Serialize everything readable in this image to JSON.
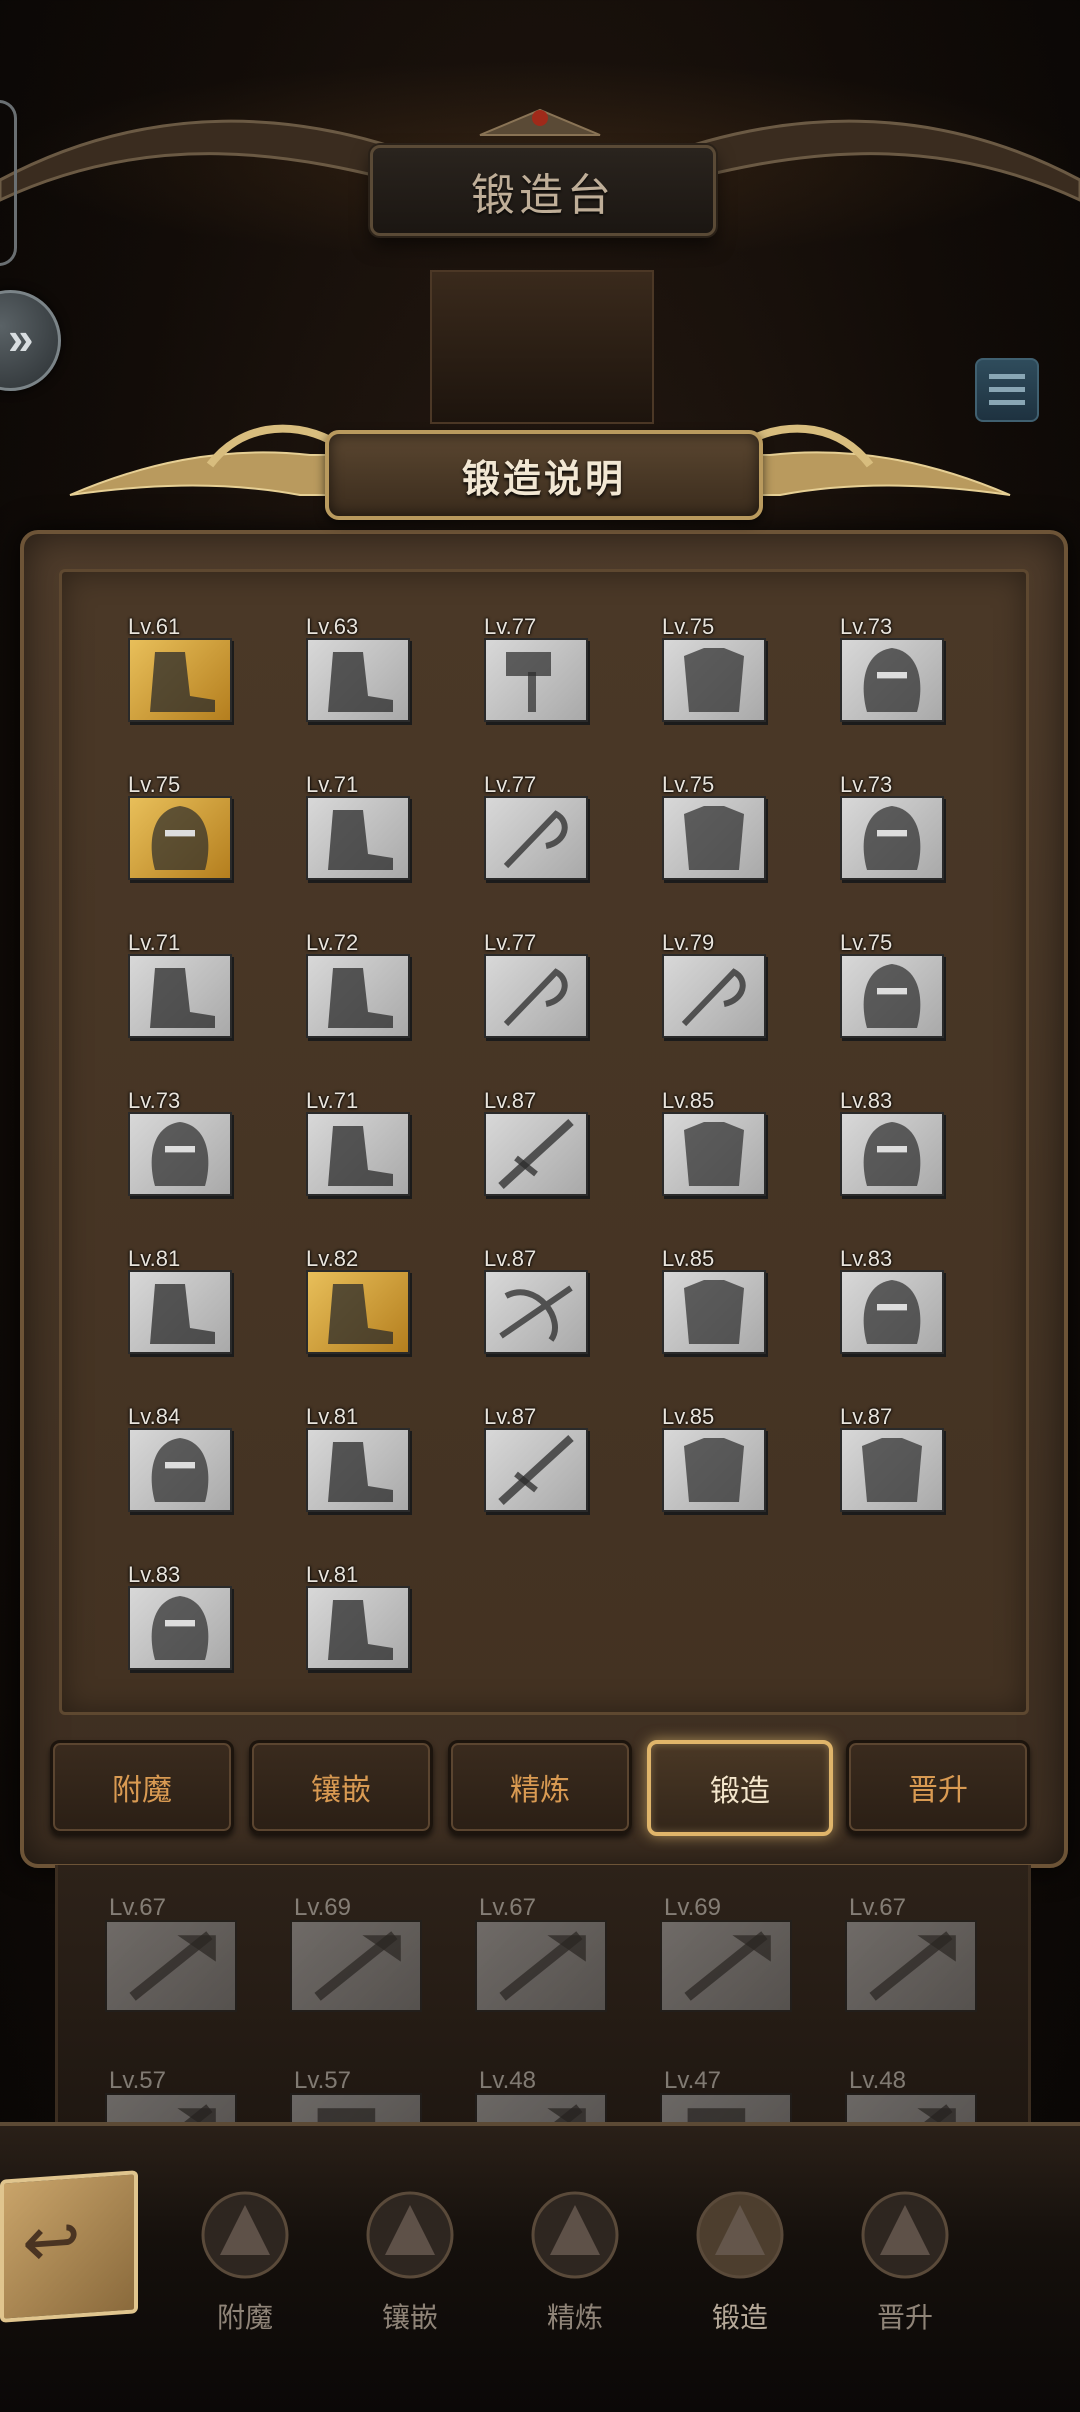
{
  "window_title": "锻造台",
  "panel_title": "锻造说明",
  "items": [
    {
      "lv": "Lv.61",
      "gold": true,
      "icon": "boots-icon"
    },
    {
      "lv": "Lv.63",
      "gold": false,
      "icon": "boots-icon"
    },
    {
      "lv": "Lv.77",
      "gold": false,
      "icon": "hammer-icon"
    },
    {
      "lv": "Lv.75",
      "gold": false,
      "icon": "armor-icon"
    },
    {
      "lv": "Lv.73",
      "gold": false,
      "icon": "helmet-icon"
    },
    {
      "lv": "Lv.75",
      "gold": true,
      "icon": "crown-helmet-icon"
    },
    {
      "lv": "Lv.71",
      "gold": false,
      "icon": "boots-icon"
    },
    {
      "lv": "Lv.77",
      "gold": false,
      "icon": "scythe-icon"
    },
    {
      "lv": "Lv.75",
      "gold": false,
      "icon": "armor-icon"
    },
    {
      "lv": "Lv.73",
      "gold": false,
      "icon": "helmet-icon"
    },
    {
      "lv": "Lv.71",
      "gold": false,
      "icon": "boots-icon"
    },
    {
      "lv": "Lv.72",
      "gold": false,
      "icon": "boots-icon"
    },
    {
      "lv": "Lv.77",
      "gold": false,
      "icon": "scythe-icon"
    },
    {
      "lv": "Lv.79",
      "gold": false,
      "icon": "scythe-icon"
    },
    {
      "lv": "Lv.75",
      "gold": false,
      "icon": "helmet-icon"
    },
    {
      "lv": "Lv.73",
      "gold": false,
      "icon": "helmet-icon"
    },
    {
      "lv": "Lv.71",
      "gold": false,
      "icon": "boots-icon"
    },
    {
      "lv": "Lv.87",
      "gold": false,
      "icon": "sword-icon"
    },
    {
      "lv": "Lv.85",
      "gold": false,
      "icon": "armor-icon"
    },
    {
      "lv": "Lv.83",
      "gold": false,
      "icon": "helmet-icon"
    },
    {
      "lv": "Lv.81",
      "gold": false,
      "icon": "boots-icon"
    },
    {
      "lv": "Lv.82",
      "gold": true,
      "icon": "boots-icon"
    },
    {
      "lv": "Lv.87",
      "gold": false,
      "icon": "crossbow-icon"
    },
    {
      "lv": "Lv.85",
      "gold": false,
      "icon": "armor-icon"
    },
    {
      "lv": "Lv.83",
      "gold": false,
      "icon": "helmet-icon"
    },
    {
      "lv": "Lv.84",
      "gold": false,
      "icon": "helmet-icon"
    },
    {
      "lv": "Lv.81",
      "gold": false,
      "icon": "boots-icon"
    },
    {
      "lv": "Lv.87",
      "gold": false,
      "icon": "spear-icon"
    },
    {
      "lv": "Lv.85",
      "gold": false,
      "icon": "armor-icon"
    },
    {
      "lv": "Lv.87",
      "gold": false,
      "icon": "armor-icon"
    },
    {
      "lv": "Lv.83",
      "gold": false,
      "icon": "helmet-icon"
    },
    {
      "lv": "Lv.81",
      "gold": false,
      "icon": "boots-icon"
    }
  ],
  "tabs": [
    {
      "label": "附魔",
      "active": false
    },
    {
      "label": "镶嵌",
      "active": false
    },
    {
      "label": "精炼",
      "active": false
    },
    {
      "label": "锻造",
      "active": true
    },
    {
      "label": "晋升",
      "active": false
    }
  ],
  "lower_items": [
    {
      "lv": "Lv.67",
      "icon": "mace-icon"
    },
    {
      "lv": "Lv.69",
      "icon": "axe-icon"
    },
    {
      "lv": "Lv.67",
      "icon": "axe-icon"
    },
    {
      "lv": "Lv.69",
      "icon": "axe-icon"
    },
    {
      "lv": "Lv.67",
      "icon": "axe-icon"
    },
    {
      "lv": "Lv.57",
      "icon": "mace-icon"
    },
    {
      "lv": "Lv.57",
      "icon": "hammer-icon"
    },
    {
      "lv": "Lv.48",
      "icon": "mace-icon"
    },
    {
      "lv": "Lv.47",
      "icon": "hammer-icon"
    },
    {
      "lv": "Lv.48",
      "icon": "mace-icon"
    }
  ],
  "bottom_nav": [
    {
      "label": "附魔",
      "icon": "enchant-icon"
    },
    {
      "label": "镶嵌",
      "icon": "inlay-icon"
    },
    {
      "label": "精炼",
      "icon": "refine-icon"
    },
    {
      "label": "锻造",
      "icon": "forge-icon",
      "active": true
    },
    {
      "label": "晋升",
      "icon": "promote-icon"
    }
  ],
  "colors": {
    "tab_text": "#d99a52",
    "active_border": "#e0b56a",
    "panel": "#4a3827"
  }
}
